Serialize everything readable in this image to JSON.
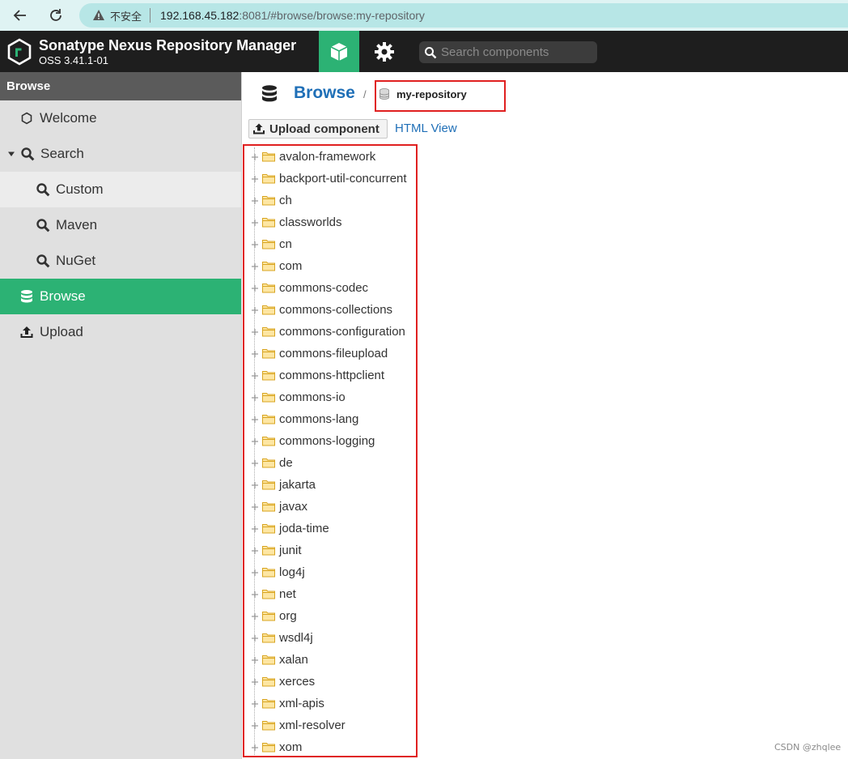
{
  "browser": {
    "security_label": "不安全",
    "url_host": "192.168.45.182",
    "url_rest": ":8081/#browse/browse:my-repository"
  },
  "header": {
    "title": "Sonatype Nexus Repository Manager",
    "version": "OSS 3.41.1-01",
    "search_placeholder": "Search components"
  },
  "sidebar": {
    "title": "Browse",
    "items": [
      {
        "label": "Welcome"
      },
      {
        "label": "Search"
      },
      {
        "label": "Custom"
      },
      {
        "label": "Maven"
      },
      {
        "label": "NuGet"
      },
      {
        "label": "Browse"
      },
      {
        "label": "Upload"
      }
    ]
  },
  "main": {
    "breadcrumb_root": "Browse",
    "breadcrumb_separator": "/",
    "repository": "my-repository",
    "upload_label": "Upload component",
    "html_view_label": "HTML View",
    "tree": [
      "avalon-framework",
      "backport-util-concurrent",
      "ch",
      "classworlds",
      "cn",
      "com",
      "commons-codec",
      "commons-collections",
      "commons-configuration",
      "commons-fileupload",
      "commons-httpclient",
      "commons-io",
      "commons-lang",
      "commons-logging",
      "de",
      "jakarta",
      "javax",
      "joda-time",
      "junit",
      "log4j",
      "net",
      "org",
      "wsdl4j",
      "xalan",
      "xerces",
      "xml-apis",
      "xml-resolver",
      "xom"
    ]
  },
  "watermark": "CSDN @zhqlee",
  "colors": {
    "accent_green": "#2cb274",
    "link_blue": "#1f6fb7",
    "highlight_red": "#e02020",
    "header_dark": "#1e1e1e"
  }
}
